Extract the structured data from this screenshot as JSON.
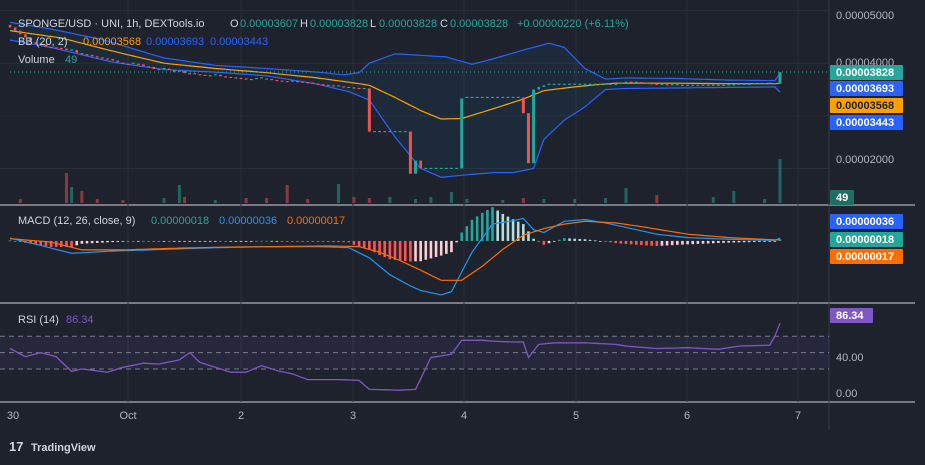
{
  "pair_title": "SPONGE/USD · UNI, 1h, DEXTools.io",
  "ohlc": {
    "open_label": "O",
    "open": "0.00003607",
    "high_label": "H",
    "high": "0.00003828",
    "low_label": "L",
    "low": "0.00003828",
    "close_label": "C",
    "close": "0.00003828",
    "change": "+0.00000220 (+6.11%)"
  },
  "bb_legend": {
    "label": "BB (20, 2)",
    "basis": "0.00003568",
    "upper": "0.00003693",
    "lower": "0.00003443"
  },
  "volume_legend": {
    "label": "Volume",
    "value": "49"
  },
  "macd_legend": {
    "label": "MACD (12, 26, close, 9)",
    "hist": "0.00000018",
    "macd": "0.00000036",
    "signal": "0.00000017"
  },
  "rsi_legend": {
    "label": "RSI (14)",
    "value": "86.34"
  },
  "price_axis_ticks": [
    "0.00005000",
    "0.00004000",
    "0.00002000"
  ],
  "price_badges": {
    "last": "0.00003828",
    "upper": "0.00003693",
    "basis": "0.00003568",
    "lower": "0.00003443",
    "volume": "49"
  },
  "macd_badges": {
    "macd": "0.00000036",
    "hist": "0.00000018",
    "signal": "0.00000017"
  },
  "rsi_axis_ticks": [
    "40.00",
    "0.00"
  ],
  "rsi_badge": "86.34",
  "time_ticks": [
    "30",
    "Oct",
    "2",
    "3",
    "4",
    "5",
    "6",
    "7"
  ],
  "brand": "TradingView",
  "colors": {
    "background": "#1e222d",
    "up": "#26a69a",
    "down": "#ef5350",
    "bb_band": "#2962ff",
    "bb_basis": "#ffa000",
    "macd_line": "#2196f3",
    "signal_line": "#ff6d00",
    "rsi_line": "#7e57c2",
    "badge_blue": "#2962ff",
    "badge_green": "#26a69a",
    "badge_orange": "#ff6d00"
  },
  "chart_data": {
    "type": "candlestick",
    "x_ticks": [
      "30",
      "Oct",
      "2",
      "3",
      "4",
      "5",
      "6",
      "7"
    ],
    "price_ylim": [
      1.4e-05,
      5.05e-05
    ],
    "candle_keys": [
      [
        0,
        4.68e-05
      ],
      [
        1,
        4.62e-05
      ],
      [
        2,
        4.55e-05
      ],
      [
        3,
        4.49e-05
      ],
      [
        4,
        4.4e-05
      ],
      [
        5,
        4.37e-05
      ],
      [
        6,
        4.36e-05
      ],
      [
        7,
        4.31e-05
      ],
      [
        8,
        4.3e-05
      ],
      [
        9,
        4.29e-05
      ],
      [
        10,
        4.28e-05
      ],
      [
        11,
        4.25e-05
      ],
      [
        12,
        4.25e-05
      ],
      [
        13,
        4.2e-05
      ],
      [
        14,
        4.18e-05
      ],
      [
        15,
        4.16e-05
      ],
      [
        16,
        4.13e-05
      ],
      [
        17,
        4.12e-05
      ],
      [
        18,
        4.1e-05
      ],
      [
        19,
        4.08e-05
      ],
      [
        20,
        4.05e-05
      ],
      [
        21,
        4.02e-05
      ],
      [
        22,
        4e-05
      ],
      [
        23,
        3.98e-05
      ],
      [
        24,
        4e-05
      ],
      [
        25,
        3.98e-05
      ],
      [
        26,
        3.95e-05
      ],
      [
        27,
        3.93e-05
      ],
      [
        28,
        3.89e-05
      ],
      [
        29,
        3.88e-05
      ],
      [
        30,
        3.9e-05
      ],
      [
        31,
        3.87e-05
      ],
      [
        32,
        3.83e-05
      ],
      [
        33,
        3.85e-05
      ],
      [
        34,
        3.81e-05
      ],
      [
        35,
        3.8e-05
      ],
      [
        36,
        3.8e-05
      ],
      [
        37,
        3.78e-05
      ],
      [
        38,
        3.77e-05
      ],
      [
        39,
        3.76e-05
      ],
      [
        40,
        3.78e-05
      ],
      [
        41,
        3.75e-05
      ],
      [
        42,
        3.74e-05
      ],
      [
        43,
        3.73e-05
      ],
      [
        44,
        3.72e-05
      ],
      [
        45,
        3.71e-05
      ],
      [
        46,
        3.7e-05
      ],
      [
        47,
        3.69e-05
      ],
      [
        48,
        3.71e-05
      ],
      [
        49,
        3.72e-05
      ],
      [
        50,
        3.7e-05
      ],
      [
        51,
        3.69e-05
      ],
      [
        52,
        3.67e-05
      ],
      [
        53,
        3.66e-05
      ],
      [
        54,
        3.65e-05
      ],
      [
        55,
        3.66e-05
      ],
      [
        56,
        3.65e-05
      ],
      [
        57,
        3.64e-05
      ],
      [
        58,
        3.63e-05
      ],
      [
        59,
        3.62e-05
      ],
      [
        60,
        3.6e-05
      ],
      [
        61,
        3.59e-05
      ],
      [
        62,
        3.58e-05
      ],
      [
        63,
        3.57e-05
      ],
      [
        64,
        3.57e-05
      ],
      [
        65,
        3.55e-05
      ],
      [
        66,
        3.54e-05
      ],
      [
        67,
        3.53e-05
      ],
      [
        68,
        3.52e-05
      ],
      [
        69,
        3.52e-05
      ],
      [
        70,
        2.7e-05
      ],
      [
        71,
        2.7e-05
      ],
      [
        72,
        2.7e-05
      ],
      [
        73,
        2.7e-05
      ],
      [
        74,
        2.7e-05
      ],
      [
        75,
        2.7e-05
      ],
      [
        76,
        2.7e-05
      ],
      [
        77,
        2.7e-05
      ],
      [
        78,
        1.9e-05
      ],
      [
        79,
        2.15e-05
      ],
      [
        80,
        2e-05
      ],
      [
        81,
        2e-05
      ],
      [
        82,
        2e-05
      ],
      [
        83,
        2e-05
      ],
      [
        84,
        2e-05
      ],
      [
        85,
        2e-05
      ],
      [
        86,
        2e-05
      ],
      [
        87,
        2e-05
      ],
      [
        88,
        3.33e-05
      ],
      [
        89,
        3.35e-05
      ],
      [
        90,
        3.35e-05
      ],
      [
        91,
        3.35e-05
      ],
      [
        92,
        3.35e-05
      ],
      [
        93,
        3.35e-05
      ],
      [
        94,
        3.35e-05
      ],
      [
        95,
        3.35e-05
      ],
      [
        96,
        3.35e-05
      ],
      [
        97,
        3.35e-05
      ],
      [
        98,
        3.35e-05
      ],
      [
        99,
        3.35e-05
      ],
      [
        100,
        3.05e-05
      ],
      [
        101,
        2.1e-05
      ],
      [
        102,
        3.5e-05
      ],
      [
        103,
        3.55e-05
      ],
      [
        104,
        3.58e-05
      ],
      [
        105,
        3.6e-05
      ],
      [
        106,
        3.6e-05
      ],
      [
        107,
        3.6e-05
      ],
      [
        108,
        3.6e-05
      ],
      [
        109,
        3.6e-05
      ],
      [
        110,
        3.6e-05
      ],
      [
        111,
        3.6e-05
      ],
      [
        112,
        3.6e-05
      ],
      [
        113,
        3.6e-05
      ],
      [
        114,
        3.6e-05
      ],
      [
        115,
        3.6e-05
      ],
      [
        116,
        3.6e-05
      ],
      [
        117,
        3.6e-05
      ],
      [
        118,
        3.6e-05
      ],
      [
        119,
        3.62e-05
      ],
      [
        120,
        3.65e-05
      ],
      [
        121,
        3.64e-05
      ],
      [
        122,
        3.64e-05
      ],
      [
        123,
        3.63e-05
      ],
      [
        124,
        3.62e-05
      ],
      [
        125,
        3.61e-05
      ],
      [
        126,
        3.6e-05
      ],
      [
        127,
        3.6e-05
      ],
      [
        128,
        3.59e-05
      ],
      [
        129,
        3.59e-05
      ],
      [
        130,
        3.59e-05
      ],
      [
        131,
        3.58e-05
      ],
      [
        132,
        3.58e-05
      ],
      [
        133,
        3.58e-05
      ],
      [
        134,
        3.58e-05
      ],
      [
        135,
        3.58e-05
      ],
      [
        136,
        3.58e-05
      ],
      [
        137,
        3.58e-05
      ],
      [
        138,
        3.58e-05
      ],
      [
        139,
        3.58e-05
      ],
      [
        140,
        3.59e-05
      ],
      [
        141,
        3.59e-05
      ],
      [
        142,
        3.6e-05
      ],
      [
        143,
        3.6e-05
      ],
      [
        144,
        3.6e-05
      ],
      [
        145,
        3.61e-05
      ],
      [
        146,
        3.61e-05
      ],
      [
        147,
        3.61e-05
      ],
      [
        148,
        3.62e-05
      ],
      [
        149,
        3.61e-05
      ],
      [
        150,
        3.83e-05
      ]
    ],
    "bb_upper_keys": [
      [
        0,
        4.78e-05
      ],
      [
        8,
        4.65e-05
      ],
      [
        18,
        4.45e-05
      ],
      [
        30,
        4.1e-05
      ],
      [
        40,
        3.96e-05
      ],
      [
        50,
        3.9e-05
      ],
      [
        60,
        3.83e-05
      ],
      [
        65,
        3.78e-05
      ],
      [
        68,
        3.82e-05
      ],
      [
        70,
        4e-05
      ],
      [
        75,
        4.18e-05
      ],
      [
        85,
        4.12e-05
      ],
      [
        90,
        3.98e-05
      ],
      [
        94,
        4.08e-05
      ],
      [
        100,
        4.25e-05
      ],
      [
        105,
        4.38e-05
      ],
      [
        108,
        4.3e-05
      ],
      [
        112,
        3.9e-05
      ],
      [
        116,
        3.7e-05
      ],
      [
        120,
        3.72e-05
      ],
      [
        130,
        3.71e-05
      ],
      [
        140,
        3.68e-05
      ],
      [
        149,
        3.67e-05
      ],
      [
        150,
        3.81e-05
      ]
    ],
    "bb_basis_keys": [
      [
        0,
        4.62e-05
      ],
      [
        10,
        4.48e-05
      ],
      [
        20,
        4.23e-05
      ],
      [
        30,
        4e-05
      ],
      [
        40,
        3.9e-05
      ],
      [
        50,
        3.82e-05
      ],
      [
        60,
        3.72e-05
      ],
      [
        66,
        3.64e-05
      ],
      [
        70,
        3.58e-05
      ],
      [
        75,
        3.35e-05
      ],
      [
        80,
        3.1e-05
      ],
      [
        84,
        2.94e-05
      ],
      [
        88,
        2.95e-05
      ],
      [
        94,
        3.13e-05
      ],
      [
        100,
        3.32e-05
      ],
      [
        104,
        3.48e-05
      ],
      [
        110,
        3.55e-05
      ],
      [
        114,
        3.59e-05
      ],
      [
        118,
        3.62e-05
      ],
      [
        130,
        3.62e-05
      ],
      [
        140,
        3.61e-05
      ],
      [
        149,
        3.61e-05
      ],
      [
        150,
        3.62e-05
      ]
    ],
    "bb_lower_keys": [
      [
        0,
        4.44e-05
      ],
      [
        8,
        4.3e-05
      ],
      [
        20,
        4.02e-05
      ],
      [
        30,
        3.88e-05
      ],
      [
        40,
        3.83e-05
      ],
      [
        50,
        3.76e-05
      ],
      [
        60,
        3.6e-05
      ],
      [
        66,
        3.46e-05
      ],
      [
        70,
        3.3e-05
      ],
      [
        75,
        2.6e-05
      ],
      [
        80,
        2e-05
      ],
      [
        84,
        1.83e-05
      ],
      [
        88,
        1.87e-05
      ],
      [
        94,
        1.92e-05
      ],
      [
        98,
        1.92e-05
      ],
      [
        102,
        2e-05
      ],
      [
        104,
        2.55e-05
      ],
      [
        108,
        2.92e-05
      ],
      [
        112,
        3.17e-05
      ],
      [
        116,
        3.5e-05
      ],
      [
        120,
        3.52e-05
      ],
      [
        130,
        3.53e-05
      ],
      [
        140,
        3.54e-05
      ],
      [
        149,
        3.55e-05
      ],
      [
        150,
        3.45e-05
      ]
    ],
    "volume_ylim": [
      0,
      120
    ],
    "volume_keys": [
      [
        2,
        8
      ],
      [
        11,
        60
      ],
      [
        12,
        32
      ],
      [
        14,
        24
      ],
      [
        17,
        8
      ],
      [
        22,
        6
      ],
      [
        30,
        10
      ],
      [
        33,
        36
      ],
      [
        34,
        12
      ],
      [
        40,
        6
      ],
      [
        46,
        10
      ],
      [
        50,
        10
      ],
      [
        54,
        36
      ],
      [
        58,
        8
      ],
      [
        64,
        38
      ],
      [
        67,
        12
      ],
      [
        70,
        10
      ],
      [
        74,
        12
      ],
      [
        79,
        8
      ],
      [
        82,
        12
      ],
      [
        86,
        22
      ],
      [
        89,
        8
      ],
      [
        96,
        6
      ],
      [
        100,
        10
      ],
      [
        104,
        8
      ],
      [
        110,
        8
      ],
      [
        116,
        10
      ],
      [
        120,
        30
      ],
      [
        126,
        16
      ],
      [
        137,
        12
      ],
      [
        141,
        24
      ],
      [
        147,
        8
      ],
      [
        150,
        88
      ]
    ],
    "macd_ylim": [
      -1.05e-05,
      5.5e-06
    ],
    "macd_keys": [
      [
        0,
        5e-07
      ],
      [
        6,
        -8e-07
      ],
      [
        12,
        -2.2e-06
      ],
      [
        20,
        -1.8e-06
      ],
      [
        30,
        -1.5e-06
      ],
      [
        40,
        -1.2e-06
      ],
      [
        50,
        -1e-06
      ],
      [
        60,
        -1e-06
      ],
      [
        66,
        -1.2e-06
      ],
      [
        70,
        -3e-06
      ],
      [
        74,
        -6e-06
      ],
      [
        78,
        -8e-06
      ],
      [
        80,
        -8.8e-06
      ],
      [
        84,
        -9.6e-06
      ],
      [
        86,
        -9e-06
      ],
      [
        90,
        -2e-06
      ],
      [
        94,
        3e-06
      ],
      [
        98,
        3.6e-06
      ],
      [
        100,
        4e-06
      ],
      [
        102,
        2e-06
      ],
      [
        104,
        1.5e-06
      ],
      [
        108,
        3.5e-06
      ],
      [
        112,
        3.8e-06
      ],
      [
        116,
        3.2e-06
      ],
      [
        120,
        2.4e-06
      ],
      [
        126,
        1.2e-06
      ],
      [
        132,
        6e-07
      ],
      [
        140,
        3e-07
      ],
      [
        149,
        1e-07
      ],
      [
        150,
        5e-07
      ]
    ],
    "signal_keys": [
      [
        0,
        4e-07
      ],
      [
        8,
        -2e-07
      ],
      [
        14,
        -1.6e-06
      ],
      [
        22,
        -1.6e-06
      ],
      [
        32,
        -1.3e-06
      ],
      [
        42,
        -1.1e-06
      ],
      [
        52,
        -1e-06
      ],
      [
        62,
        -9e-07
      ],
      [
        68,
        -1e-06
      ],
      [
        72,
        -2e-06
      ],
      [
        76,
        -3.5e-06
      ],
      [
        80,
        -5.2e-06
      ],
      [
        84,
        -7e-06
      ],
      [
        88,
        -7e-06
      ],
      [
        92,
        -4.5e-06
      ],
      [
        96,
        -1.5e-06
      ],
      [
        100,
        1e-06
      ],
      [
        104,
        2.2e-06
      ],
      [
        108,
        3e-06
      ],
      [
        112,
        3.5e-06
      ],
      [
        118,
        3.2e-06
      ],
      [
        124,
        2.4e-06
      ],
      [
        132,
        1.2e-06
      ],
      [
        140,
        6e-07
      ],
      [
        149,
        2e-07
      ],
      [
        150,
        2e-07
      ]
    ],
    "rsi_ylim": [
      -8,
      107
    ],
    "rsi_guides": [
      70,
      50,
      30
    ],
    "rsi_keys": [
      [
        0,
        55
      ],
      [
        3,
        45
      ],
      [
        6,
        50
      ],
      [
        9,
        45
      ],
      [
        12,
        27
      ],
      [
        14,
        30
      ],
      [
        19,
        26
      ],
      [
        22,
        32
      ],
      [
        26,
        37
      ],
      [
        29,
        36
      ],
      [
        33,
        41
      ],
      [
        35,
        50
      ],
      [
        37,
        38
      ],
      [
        40,
        32
      ],
      [
        43,
        26
      ],
      [
        46,
        26
      ],
      [
        49,
        34
      ],
      [
        52,
        28
      ],
      [
        55,
        24
      ],
      [
        58,
        17
      ],
      [
        64,
        17
      ],
      [
        68,
        16
      ],
      [
        70,
        5
      ],
      [
        76,
        4
      ],
      [
        79,
        5
      ],
      [
        82,
        44
      ],
      [
        84,
        46
      ],
      [
        86,
        48
      ],
      [
        88,
        65
      ],
      [
        92,
        65
      ],
      [
        94,
        64
      ],
      [
        98,
        63
      ],
      [
        100,
        63
      ],
      [
        101,
        44
      ],
      [
        103,
        60
      ],
      [
        106,
        62
      ],
      [
        112,
        62
      ],
      [
        118,
        60
      ],
      [
        120,
        58
      ],
      [
        126,
        55
      ],
      [
        132,
        56
      ],
      [
        138,
        54
      ],
      [
        142,
        58
      ],
      [
        148,
        59
      ],
      [
        149,
        70
      ],
      [
        150,
        86
      ]
    ]
  }
}
